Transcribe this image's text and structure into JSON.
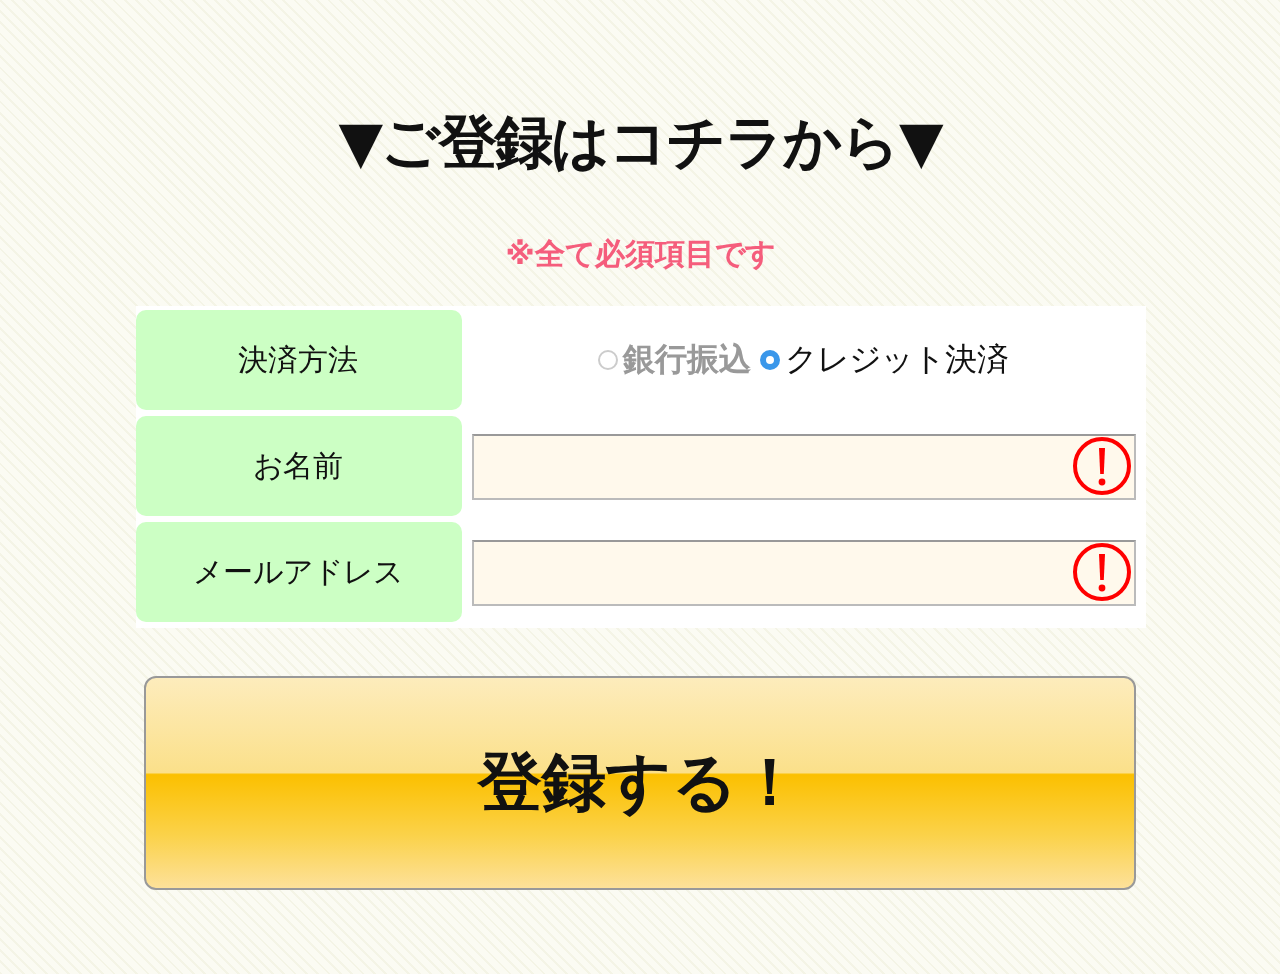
{
  "heading": "▼ご登録はコチラから▼",
  "note": "※全て必須項目です",
  "rows": [
    {
      "kind": "radio",
      "label": "決済方法",
      "options": [
        {
          "label": "銀行振込",
          "selected": false
        },
        {
          "label": "クレジット決済",
          "selected": true
        }
      ]
    },
    {
      "kind": "input",
      "label": "お名前",
      "invalid": true
    },
    {
      "kind": "input",
      "label": "メールアドレス",
      "invalid": true
    }
  ],
  "submit": "登録する！"
}
